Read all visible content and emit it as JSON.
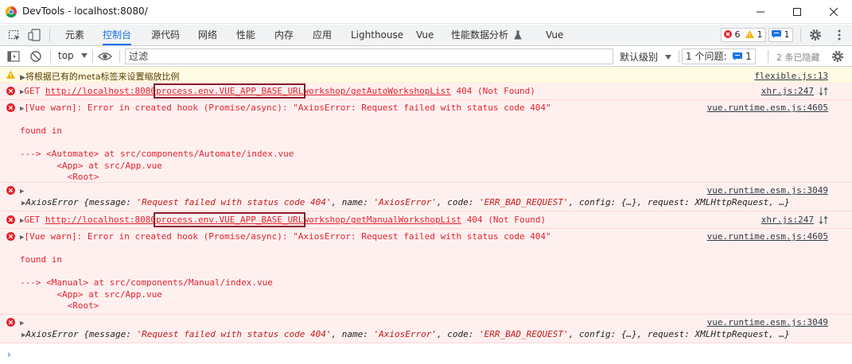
{
  "window": {
    "title": "DevTools - localhost:8080/"
  },
  "tabs": [
    {
      "label": "元素"
    },
    {
      "label": "控制台"
    },
    {
      "label": "源代码"
    },
    {
      "label": "网络"
    },
    {
      "label": "性能"
    },
    {
      "label": "内存"
    },
    {
      "label": "应用"
    },
    {
      "label": "Lighthouse"
    },
    {
      "label": "Vue"
    },
    {
      "label": "性能数据分析"
    },
    {
      "label": "Vue"
    }
  ],
  "badges": {
    "errors": "6",
    "warnings": "1",
    "messages": "1"
  },
  "toolbar": {
    "context": "top",
    "filter_placeholder": "过滤",
    "levels": "默认级别",
    "issues_label": "1 个问题:",
    "issues_count": "1",
    "hidden": "2 条已隐藏"
  },
  "messages": [
    {
      "type": "warn",
      "text": "将根据已有的meta标签来设置缩放比例",
      "source": "flexible.js:13"
    },
    {
      "type": "error",
      "prefix": "GET ",
      "url_host": "http://localhost:8080",
      "url_highlight": "process.env.VUE_APP_BASE_URL",
      "url_rest": "workshop/getAutoWorkshopList",
      "status": " 404 (Not Found)",
      "source": "xhr.js:247"
    },
    {
      "type": "error",
      "line1": "[Vue warn]: Error in created hook (Promise/async): \"AxiosError: Request failed with status code 404\"",
      "line2": "found in",
      "line3": "---> <Automate> at src/components/Automate/index.vue",
      "line4": "       <App> at src/App.vue",
      "line5": "         <Root>",
      "source": "vue.runtime.esm.js:4605"
    },
    {
      "type": "error",
      "obj_head": "AxiosError {message: ",
      "obj_msg": "'Request failed with status code 404'",
      "obj_mid": ", name: ",
      "obj_name": "'AxiosError'",
      "obj_mid2": ", code: ",
      "obj_code": "'ERR_BAD_REQUEST'",
      "obj_tail": ", config: {…}, request: XMLHttpRequest, …}",
      "source": "vue.runtime.esm.js:3049"
    },
    {
      "type": "error",
      "prefix": "GET ",
      "url_host": "http://localhost:8080",
      "url_highlight": "process.env.VUE_APP_BASE_URL",
      "url_rest": "workshop/getManualWorkshopList",
      "status": " 404 (Not Found)",
      "source": "xhr.js:247"
    },
    {
      "type": "error",
      "line1": "[Vue warn]: Error in created hook (Promise/async): \"AxiosError: Request failed with status code 404\"",
      "line2": "found in",
      "line3": "---> <Manual> at src/components/Manual/index.vue",
      "line4": "       <App> at src/App.vue",
      "line5": "         <Root>",
      "source": "vue.runtime.esm.js:4605"
    },
    {
      "type": "error",
      "obj_head": "AxiosError {message: ",
      "obj_msg": "'Request failed with status code 404'",
      "obj_mid": ", name: ",
      "obj_name": "'AxiosError'",
      "obj_mid2": ", code: ",
      "obj_code": "'ERR_BAD_REQUEST'",
      "obj_tail": ", config: {…}, request: XMLHttpRequest, …}",
      "source": "vue.runtime.esm.js:3049"
    }
  ],
  "prompt": "›"
}
